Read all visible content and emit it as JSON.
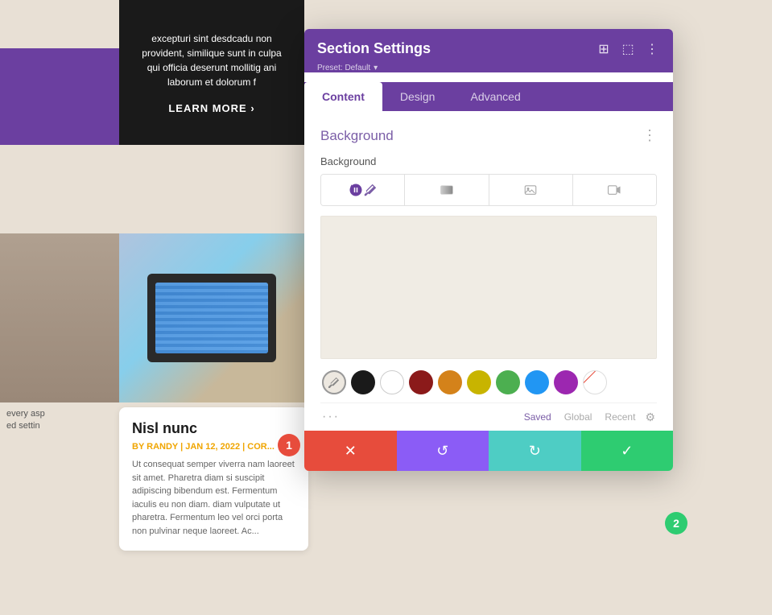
{
  "page": {
    "background_color": "#e8e0d5"
  },
  "background_content": {
    "dark_panel_text": "excepturi sint desdcadu non provident, similique sunt in culpa qui officia deserunt mollitig ani laborum et dolorum f",
    "learn_more": "LEARN MORE  ›",
    "every_asp_text": "every asp",
    "ed_setting_text": "ed settin",
    "blog_card": {
      "title": "Nisl nunc",
      "meta": "BY RANDY | JAN 12, 2022 | COR...",
      "text": "Ut consequat semper viverra nam laoreet sit amet. Pharetra diam si suscipit adipiscing bibendum est. Fermentum iaculis eu non diam. diam vulputate ut pharetra. Fermentum leo vel orci porta non pulvinar neque laoreet. Ac..."
    }
  },
  "settings_panel": {
    "title": "Section Settings",
    "preset_label": "Preset: Default",
    "preset_arrow": "▾",
    "icons": {
      "grid": "⊞",
      "columns": "⬚",
      "dots": "⋮"
    },
    "tabs": [
      {
        "label": "Content",
        "active": true
      },
      {
        "label": "Design",
        "active": false
      },
      {
        "label": "Advanced",
        "active": false
      }
    ],
    "background_section": {
      "title": "Background",
      "menu_icon": "⋮",
      "label": "Background",
      "type_tabs": [
        {
          "type": "color",
          "active": true
        },
        {
          "type": "gradient"
        },
        {
          "type": "image"
        },
        {
          "type": "video"
        }
      ],
      "preview_color": "#f0ece4",
      "color_swatches": [
        {
          "color": "#f0ece4",
          "type": "eyedropper",
          "active": true
        },
        {
          "color": "#1a1a1a"
        },
        {
          "color": "transparent"
        },
        {
          "color": "#8B1A1A"
        },
        {
          "color": "#D4A017"
        },
        {
          "color": "#C8B400"
        },
        {
          "color": "#4CAF50"
        },
        {
          "color": "#2196F3"
        },
        {
          "color": "#9C27B0"
        },
        {
          "color": "diagonal"
        }
      ],
      "color_tabs": {
        "dots": "···",
        "saved_label": "Saved",
        "global_label": "Global",
        "recent_label": "Recent",
        "active_tab": "Saved"
      }
    },
    "action_buttons": {
      "cancel": "✕",
      "undo": "↺",
      "redo": "↻",
      "save": "✓"
    }
  },
  "badges": [
    {
      "number": "1",
      "color": "#e74c3c"
    },
    {
      "number": "2",
      "color": "#2ecc71"
    }
  ]
}
